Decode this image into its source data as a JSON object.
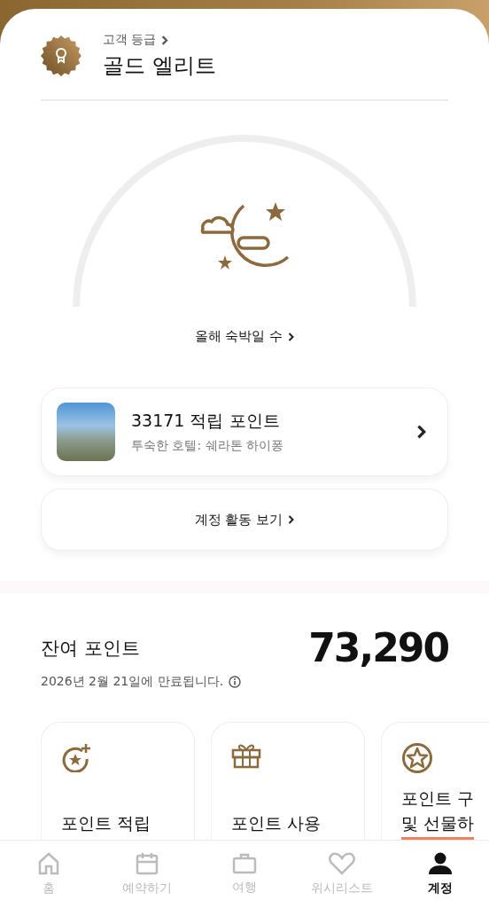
{
  "tier": {
    "caption": "고객 등급",
    "name": "골드 엘리트"
  },
  "stays": {
    "label": "올해 숙박일 수"
  },
  "points_card": {
    "title": "33171 적립 포인트",
    "subtitle": "투숙한 호텔: 쉐라톤 하이퐁"
  },
  "activity_button": {
    "label": "계정 활동 보기"
  },
  "balance": {
    "label": "잔여 포인트",
    "value": "73,290",
    "expiry": "2026년 2월 21일에 만료됩니다."
  },
  "actions": [
    {
      "kind": "earn",
      "lines": [
        "포인트 적립"
      ],
      "highlighted": false
    },
    {
      "kind": "use",
      "lines": [
        "포인트 사용"
      ],
      "highlighted": false
    },
    {
      "kind": "buy",
      "lines": [
        "포인트 구",
        "및 선물하"
      ],
      "highlighted": true
    }
  ],
  "nav": [
    {
      "kind": "home",
      "label": "홈",
      "selected": false
    },
    {
      "kind": "calendar",
      "label": "예약하기",
      "selected": false
    },
    {
      "kind": "suitcase",
      "label": "여행",
      "selected": false
    },
    {
      "kind": "heart",
      "label": "위시리스트",
      "selected": false
    },
    {
      "kind": "person",
      "label": "계정",
      "selected": true
    }
  ]
}
